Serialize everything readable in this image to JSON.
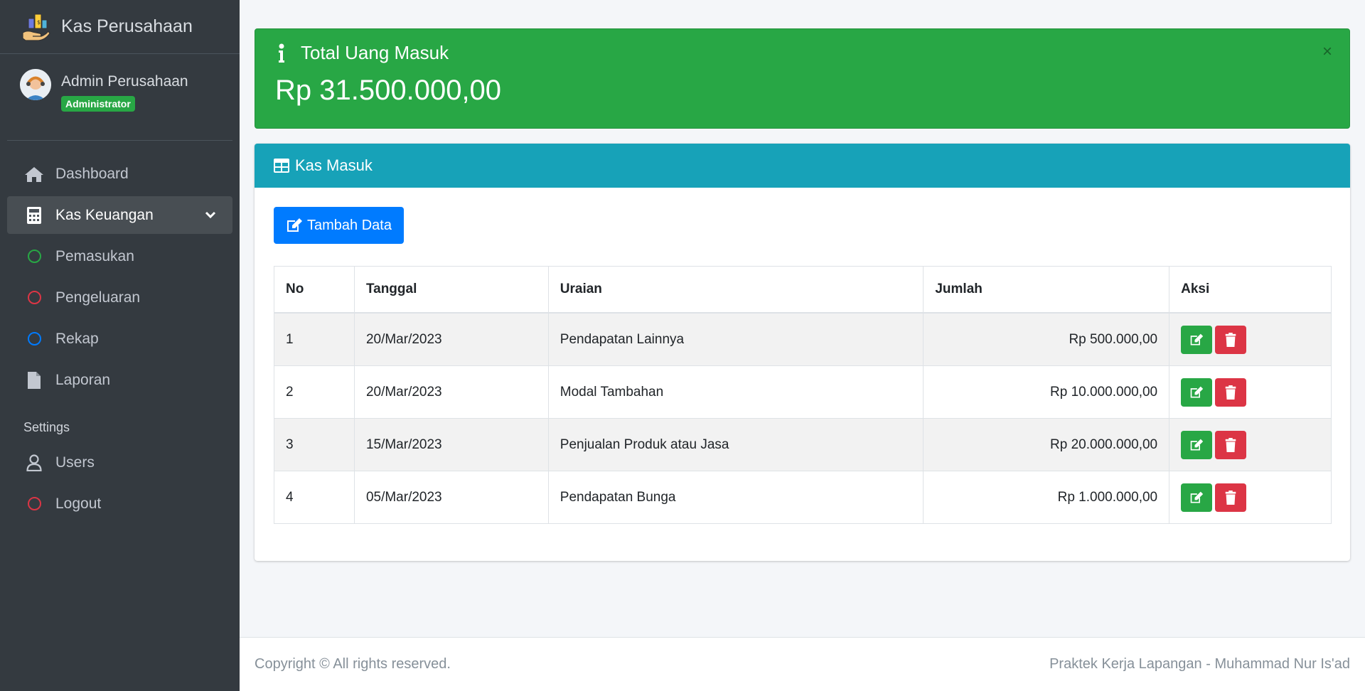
{
  "app": {
    "title": "Kas Perusahaan"
  },
  "user": {
    "name": "Admin Perusahaan",
    "role": "Administrator"
  },
  "sidebar": {
    "items": [
      {
        "label": "Dashboard",
        "icon": "home-icon"
      },
      {
        "label": "Kas Keuangan",
        "icon": "calculator-icon",
        "active": true
      },
      {
        "label": "Pemasukan",
        "icon": "circle-icon",
        "color": "#28a745"
      },
      {
        "label": "Pengeluaran",
        "icon": "circle-icon",
        "color": "#dc3545"
      },
      {
        "label": "Rekap",
        "icon": "circle-icon",
        "color": "#007bff"
      },
      {
        "label": "Laporan",
        "icon": "file-icon"
      }
    ],
    "settings_header": "Settings",
    "settings_items": [
      {
        "label": "Users",
        "icon": "user-icon"
      },
      {
        "label": "Logout",
        "icon": "circle-icon",
        "color": "#dc3545"
      }
    ]
  },
  "alert": {
    "title": "Total Uang Masuk",
    "value": "Rp 31.500.000,00",
    "close": "×"
  },
  "card": {
    "title": "Kas Masuk",
    "add_button": "Tambah Data",
    "columns": [
      "No",
      "Tanggal",
      "Uraian",
      "Jumlah",
      "Aksi"
    ],
    "rows": [
      {
        "no": "1",
        "tanggal": "20/Mar/2023",
        "uraian": "Pendapatan Lainnya",
        "jumlah": "Rp 500.000,00"
      },
      {
        "no": "2",
        "tanggal": "20/Mar/2023",
        "uraian": "Modal Tambahan",
        "jumlah": "Rp 10.000.000,00"
      },
      {
        "no": "3",
        "tanggal": "15/Mar/2023",
        "uraian": "Penjualan Produk atau Jasa",
        "jumlah": "Rp 20.000.000,00"
      },
      {
        "no": "4",
        "tanggal": "05/Mar/2023",
        "uraian": "Pendapatan Bunga",
        "jumlah": "Rp 1.000.000,00"
      }
    ]
  },
  "footer": {
    "left": "Copyright © All rights reserved.",
    "right": "Praktek Kerja Lapangan - Muhammad Nur Is'ad"
  },
  "colors": {
    "sidebar": "#343a40",
    "success": "#28a745",
    "info": "#17a2b8",
    "primary": "#007bff",
    "danger": "#dc3545"
  }
}
